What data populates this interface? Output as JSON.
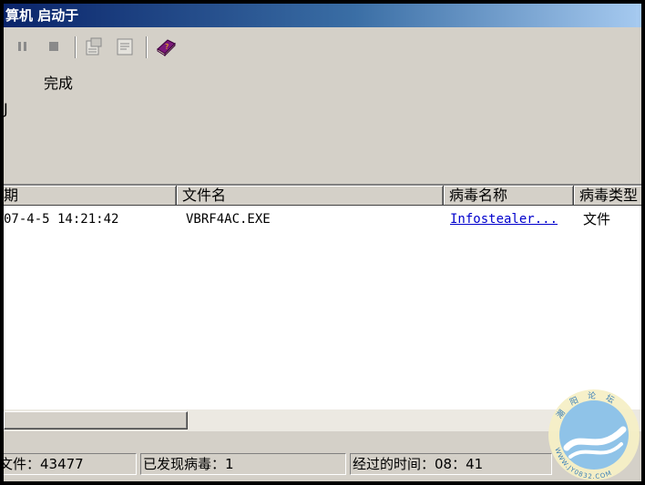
{
  "window": {
    "title": "算机 启动于"
  },
  "toolbar": {
    "buttons": [
      {
        "icon": "pause-icon"
      },
      {
        "icon": "stop-icon"
      },
      {
        "icon": "properties-icon"
      },
      {
        "icon": "report-icon"
      },
      {
        "icon": "help-book-icon"
      }
    ]
  },
  "scan": {
    "status": "完成",
    "edge_fragment": "J"
  },
  "table": {
    "columns": [
      "期",
      "文件名",
      "病毒名称",
      "病毒类型"
    ],
    "rows": [
      {
        "date": "07-4-5 14:21:42",
        "file": "VBRF4AC.EXE",
        "virus": "Infostealer...",
        "type": "文件"
      }
    ]
  },
  "statusbar": {
    "files": "文件：43477",
    "found": "已发现病毒：1",
    "elapsed": "经过的时间：08：41"
  },
  "watermark": {
    "text": "WWW.JY0832.COM",
    "chars": [
      "潮",
      "阳",
      "论",
      "坛"
    ]
  }
}
